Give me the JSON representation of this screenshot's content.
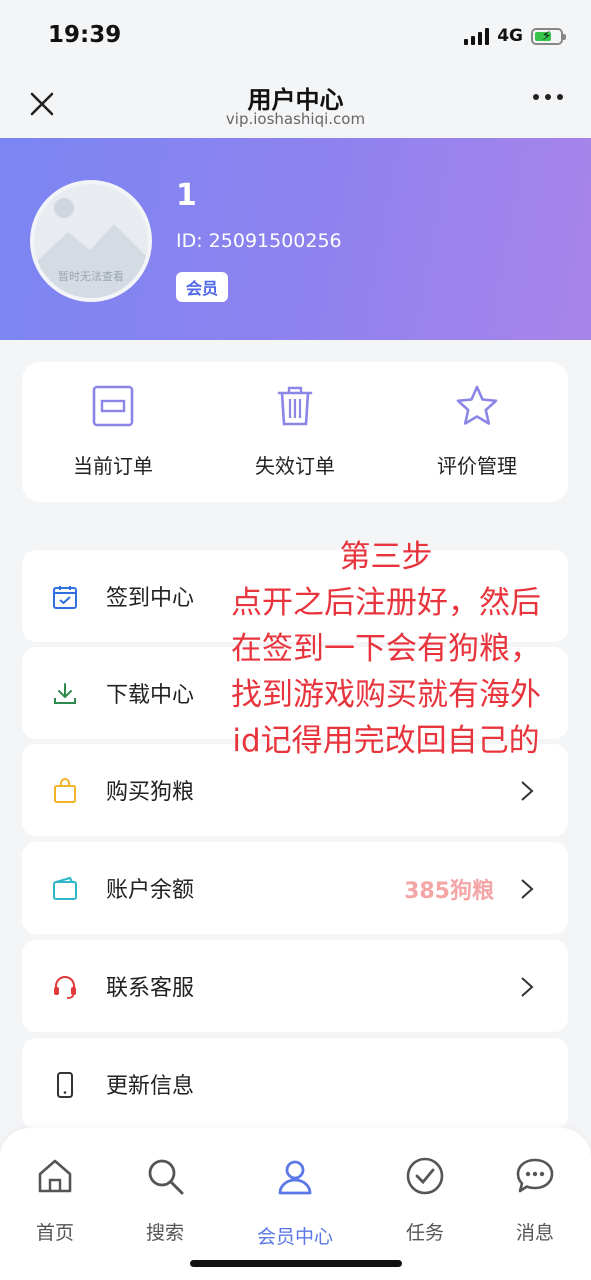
{
  "status": {
    "time": "19:39",
    "network": "4G"
  },
  "header": {
    "title": "用户中心",
    "subtitle": "vip.ioshashiqi.com"
  },
  "profile": {
    "avatar_placeholder": "暂时无法查看",
    "name": "1",
    "id": "ID: 25091500256",
    "badge": "会员"
  },
  "orders": [
    {
      "label": "当前订单",
      "icon": "order-icon"
    },
    {
      "label": "失效订单",
      "icon": "trash-icon"
    },
    {
      "label": "评价管理",
      "icon": "star-icon"
    }
  ],
  "menu": [
    {
      "label": "签到中心",
      "icon": "calendar-icon",
      "value": ""
    },
    {
      "label": "下载中心",
      "icon": "download-icon",
      "value": ""
    },
    {
      "label": "购买狗粮",
      "icon": "bag-icon",
      "value": ""
    },
    {
      "label": "账户余额",
      "icon": "wallet-icon",
      "value": "385狗粮"
    },
    {
      "label": "联系客服",
      "icon": "headset-icon",
      "value": ""
    },
    {
      "label": "更新信息",
      "icon": "phone-icon",
      "value": ""
    }
  ],
  "annotation": {
    "lines": [
      "第三步",
      "点开之后注册好，然后",
      "在签到一下会有狗粮，",
      "找到游戏购买就有海外",
      "id记得用完改回自己的"
    ],
    "color": "#e8343c"
  },
  "tabs": [
    {
      "label": "首页",
      "icon": "home-icon"
    },
    {
      "label": "搜索",
      "icon": "search-icon"
    },
    {
      "label": "会员中心",
      "icon": "user-icon",
      "active": true
    },
    {
      "label": "任务",
      "icon": "check-circle-icon"
    },
    {
      "label": "消息",
      "icon": "chat-icon"
    }
  ],
  "colors": {
    "accent": "#5b78e6",
    "banner_start": "#7b86f2",
    "banner_end": "#a884ea"
  }
}
